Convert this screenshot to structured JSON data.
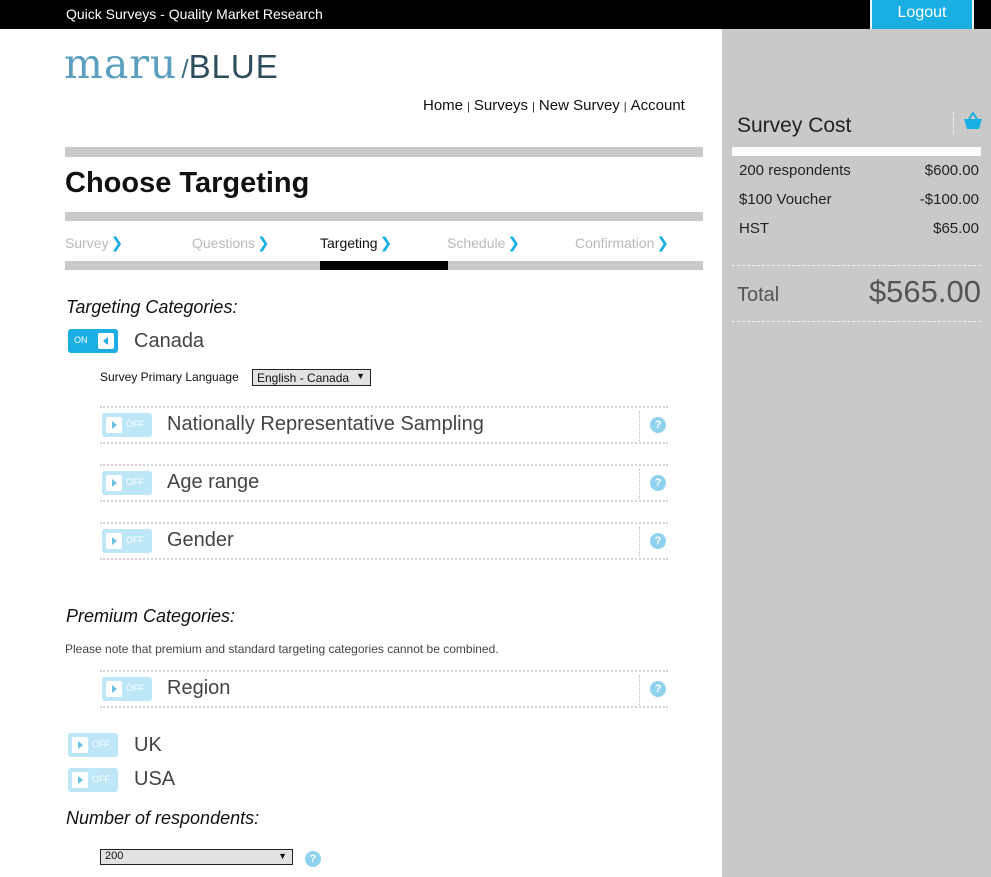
{
  "topbar": {
    "title": "Quick Surveys - Quality Market Research",
    "logout_label": "Logout"
  },
  "logo": {
    "part1": "maru",
    "slash": "/",
    "part2": "BLUE"
  },
  "nav": {
    "items": [
      "Home",
      "Surveys",
      "New Survey",
      "Account"
    ],
    "separator": "|"
  },
  "page": {
    "title": "Choose Targeting"
  },
  "steps": [
    {
      "label": "Survey",
      "active": false
    },
    {
      "label": "Questions",
      "active": false
    },
    {
      "label": "Targeting",
      "active": true
    },
    {
      "label": "Schedule",
      "active": false
    },
    {
      "label": "Confirmation",
      "active": false
    }
  ],
  "step_chevron": "❯",
  "targeting": {
    "heading": "Targeting Categories:",
    "canada": {
      "label": "Canada",
      "toggle": "ON"
    },
    "language_label": "Survey Primary Language",
    "language_value": "English - Canada",
    "categories": [
      {
        "name": "Nationally Representative Sampling",
        "toggle": "OFF"
      },
      {
        "name": "Age range",
        "toggle": "OFF"
      },
      {
        "name": "Gender",
        "toggle": "OFF"
      }
    ]
  },
  "premium": {
    "heading": "Premium Categories:",
    "note": "Please note that premium and standard targeting categories cannot be combined.",
    "categories": [
      {
        "name": "Region",
        "toggle": "OFF"
      }
    ]
  },
  "countries": [
    {
      "label": "UK",
      "toggle": "OFF"
    },
    {
      "label": "USA",
      "toggle": "OFF"
    }
  ],
  "respondents": {
    "heading": "Number of respondents:",
    "value": "200"
  },
  "help_glyph": "?",
  "select_arrow": "▼",
  "cost": {
    "title": "Survey Cost",
    "lines": [
      {
        "label": "200 respondents",
        "amount": "$600.00"
      },
      {
        "label": "$100 Voucher",
        "amount": "-$100.00"
      },
      {
        "label": "HST",
        "amount": "$65.00"
      }
    ],
    "total_label": "Total",
    "total_amount": "$565.00"
  },
  "colors": {
    "accent": "#1aaee3",
    "sidebar": "#c9c9c9",
    "toggle_off": "#bde7f7",
    "topbar": "#000000"
  },
  "icons": {
    "basket": "basket-icon",
    "help": "help-icon",
    "toggle_on": "toggle-on",
    "toggle_off": "toggle-off"
  }
}
